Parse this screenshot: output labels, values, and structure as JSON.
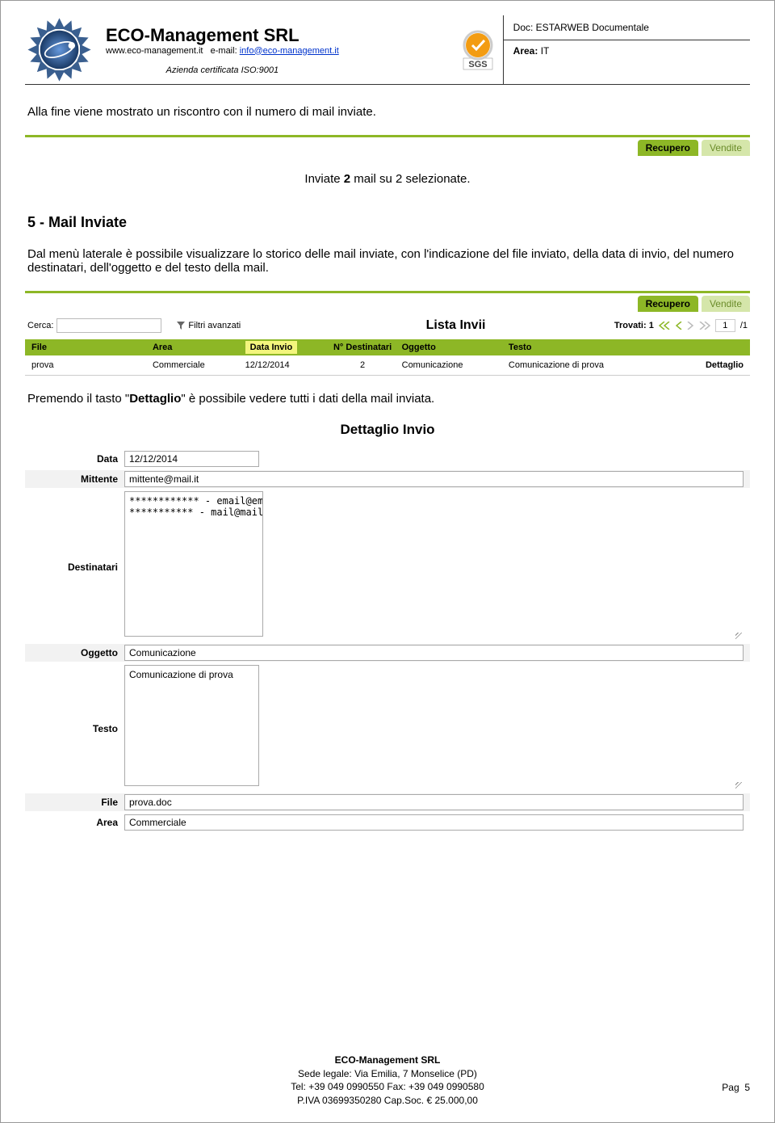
{
  "header": {
    "company_name": "ECO-Management SRL",
    "website": "www.eco-management.it",
    "email_label": "e-mail:",
    "email": "info@eco-management.it",
    "cert": "Azienda certificata ISO:9001",
    "doc_label": "Doc: ESTARWEB Documentale",
    "area_prefix": "Area:",
    "area_value": "IT"
  },
  "intro_text": "Alla fine viene mostrato un riscontro con il numero di mail inviate.",
  "tabs": {
    "recupero": "Recupero",
    "vendite": "Vendite"
  },
  "inviate_msg_pre": "Inviate ",
  "inviate_msg_bold": "2",
  "inviate_msg_post": " mail su 2 selezionate.",
  "section5_title": "5 -  Mail Inviate",
  "section5_body": "Dal menù laterale è possibile visualizzare lo storico delle mail inviate, con l'indicazione del file inviato, della data di invio, del numero destinatari, dell'oggetto e del testo della mail.",
  "list": {
    "search_label": "Cerca:",
    "filter_label": "Filtri avanzati",
    "title": "Lista Invii",
    "trovati_label": "Trovati: 1",
    "page_current": "1",
    "page_total": "/1",
    "columns": {
      "file": "File",
      "area": "Area",
      "data": "Data Invio",
      "ndest": "N° Destinatari",
      "oggetto": "Oggetto",
      "testo": "Testo"
    },
    "row": {
      "file": "prova",
      "area": "Commerciale",
      "data": "12/12/2014",
      "ndest": "2",
      "oggetto": "Comunicazione",
      "testo": "Comunicazione di prova",
      "dettaglio": "Dettaglio"
    }
  },
  "dettaglio_line_pre": "Premendo il tasto \"",
  "dettaglio_line_bold": "Dettaglio",
  "dettaglio_line_post": "\" è possibile vedere tutti i dati della mail inviata.",
  "detail": {
    "title": "Dettaglio Invio",
    "labels": {
      "data": "Data",
      "mittente": "Mittente",
      "destinatari": "Destinatari",
      "oggetto": "Oggetto",
      "testo": "Testo",
      "file": "File",
      "area": "Area"
    },
    "values": {
      "data": "12/12/2014",
      "mittente": "mittente@mail.it",
      "destinatari": "************ - email@email.it\n*********** - mail@mail.it",
      "oggetto": "Comunicazione",
      "testo": "Comunicazione di prova",
      "file": "prova.doc",
      "area": "Commerciale"
    }
  },
  "footer": {
    "company": "ECO-Management SRL",
    "sede": "Sede legale: Via Emilia, 7 Monselice (PD)",
    "tel": "Tel: +39 049 0990550    Fax: +39 049 0990580",
    "piva": "P.IVA 03699350280 Cap.Soc. € 25.000,00",
    "pag_label": "Pag",
    "pag_num": "5"
  }
}
